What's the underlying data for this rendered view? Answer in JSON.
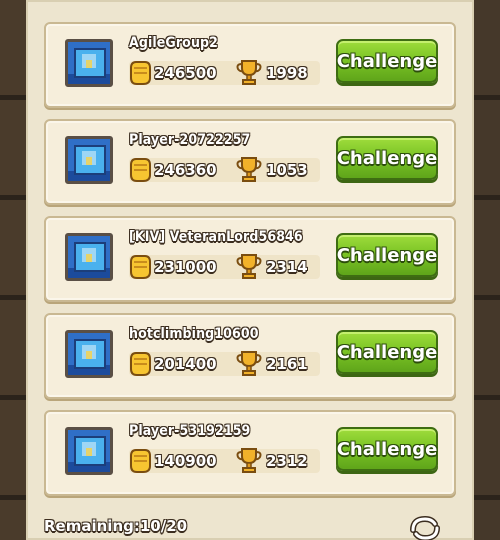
{
  "opponents": [
    {
      "name": "AgileGroup2",
      "gold": "246500",
      "trophies": "1998",
      "button": "Challenge"
    },
    {
      "name": "Player-20722257",
      "gold": "246360",
      "trophies": "1053",
      "button": "Challenge"
    },
    {
      "name": "[KIV] VeteranLord56846",
      "gold": "231000",
      "trophies": "2314",
      "button": "Challenge"
    },
    {
      "name": "hotclimbing10600",
      "gold": "201400",
      "trophies": "2161",
      "button": "Challenge"
    },
    {
      "name": "Player-53192159",
      "gold": "140900",
      "trophies": "2312",
      "button": "Challenge"
    }
  ],
  "footer": {
    "remaining": "Remaining:10/20"
  },
  "icons": {
    "gold": "gold-fist-icon",
    "trophy": "trophy-icon",
    "refresh": "refresh-icon"
  },
  "colors": {
    "button": "#7cc526",
    "panel": "#ede5cf",
    "row": "#f6eedb"
  }
}
